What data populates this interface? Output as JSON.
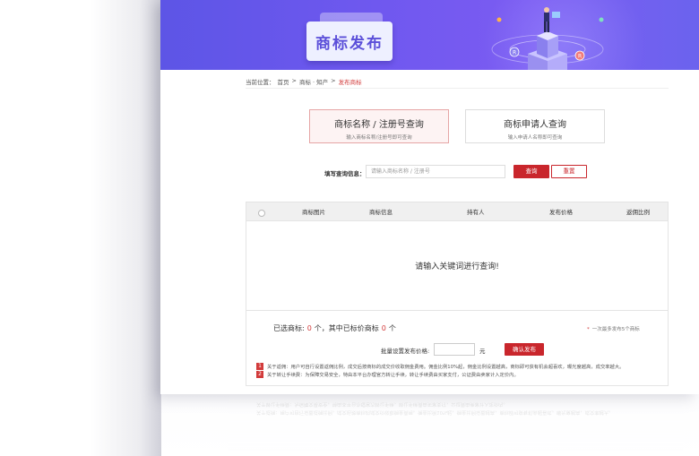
{
  "banner": {
    "title": "商标发布"
  },
  "breadcrumb": {
    "label": "当前位置：",
    "home": "首页",
    "sep": ">",
    "category": "商标 · 知产",
    "current": "发布商标"
  },
  "tabs": [
    {
      "title": "商标名称 / 注册号查询",
      "subtitle": "输入商标名称/注册号即可查询"
    },
    {
      "title": "商标申请人查询",
      "subtitle": "输入申请人名称即可查询"
    }
  ],
  "search": {
    "label": "填写查询信息：",
    "placeholder": "请输入商标名称 / 注册号",
    "query_button": "查询",
    "reset_button": "重置"
  },
  "table": {
    "headers": [
      "商标图片",
      "商标信息",
      "持有人",
      "发布价格",
      "返佣比例"
    ],
    "empty_message": "请输入关键词进行查询!"
  },
  "footer": {
    "selected_prefix": "已选商标:",
    "selected_count": "0",
    "selected_mid": "个，其中已标价商标",
    "priced_count": "0",
    "selected_suffix": "个",
    "max_note": "一次最多发布5个商标",
    "batch_label": "批量设置发布价格:",
    "unit": "元",
    "confirm_button": "确认发布",
    "notes": [
      {
        "num": "1",
        "text": "关于返佣：用户可自行设置返佣比例，成交后按商标的成交价收取佣金费用。佣金比例10%起，佣金比例设置越高，商标即可获有机会超喜欢，曝光度越高，成交率越大。"
      },
      {
        "num": "2",
        "text": "关于转让手续费：为保障交易安全，特由本平台办理官方转让手续，转让手续费由买家支付，公证费由卖家计入定价内。"
      }
    ]
  },
  "colors": {
    "accent": "#c9262c",
    "banner_start": "#5d55e6",
    "banner_end": "#7c5cf2",
    "title_text": "#5b4fd9"
  }
}
